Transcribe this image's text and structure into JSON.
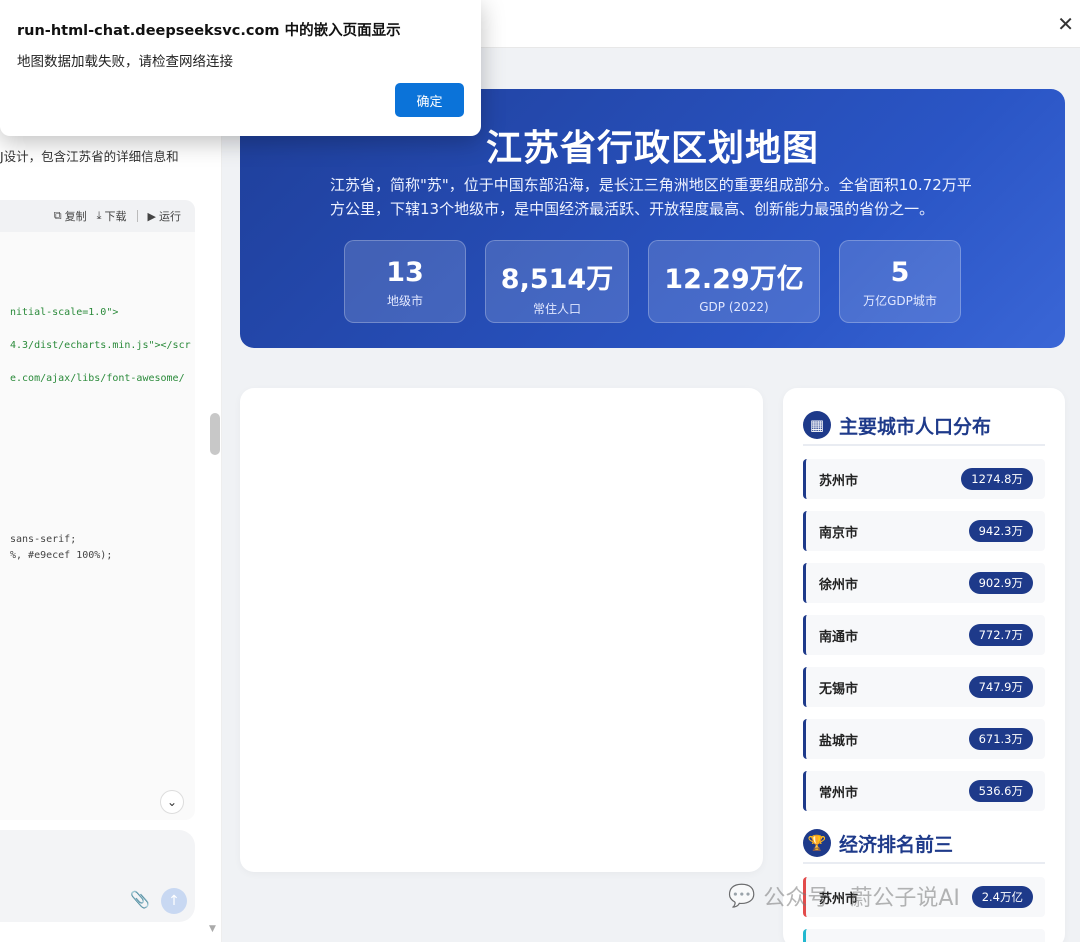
{
  "dialog": {
    "title": "run-html-chat.deepseeksvc.com 中的嵌入页面显示",
    "message": "地图数据加载失败，请检查网络连接",
    "ok_label": "确定"
  },
  "chat": {
    "description_tail": "J设计，包含江苏省的详细信息和",
    "toolbar": {
      "copy": "复制",
      "download": "下载",
      "run": "运行"
    },
    "code_lines": [
      "nitial-scale=1.0\">",
      "4.3/dist/echarts.min.js\"></scr",
      "e.com/ajax/libs/font-awesome/",
      "sans-serif;",
      "%, #e9ecef 100%);"
    ]
  },
  "hero": {
    "title": "江苏省行政区划地图",
    "description": "江苏省，简称\"苏\"，位于中国东部沿海，是长江三角洲地区的重要组成部分。全省面积10.72万平方公里，下辖13个地级市，是中国经济最活跃、开放程度最高、创新能力最强的省份之一。",
    "stats": [
      {
        "value": "13",
        "label": "地级市"
      },
      {
        "value": "8,514万",
        "label": "常住人口"
      },
      {
        "value": "12.29万亿",
        "label": "GDP (2022)"
      },
      {
        "value": "5",
        "label": "万亿GDP城市"
      }
    ]
  },
  "population": {
    "title": "主要城市人口分布",
    "icon": "city-icon",
    "cities": [
      {
        "name": "苏州市",
        "value": "1274.8万"
      },
      {
        "name": "南京市",
        "value": "942.3万"
      },
      {
        "name": "徐州市",
        "value": "902.9万"
      },
      {
        "name": "南通市",
        "value": "772.7万"
      },
      {
        "name": "无锡市",
        "value": "747.9万"
      },
      {
        "name": "盐城市",
        "value": "671.3万"
      },
      {
        "name": "常州市",
        "value": "536.6万"
      }
    ]
  },
  "economy": {
    "title": "经济排名前三",
    "icon": "trophy-icon",
    "cities": [
      {
        "name": "苏州市",
        "value": "2.4万亿"
      }
    ]
  },
  "watermark": "公众号 · 蔚公子说AI",
  "colors": {
    "accent": "#1e3a8a",
    "dialog_button": "#0b73d9",
    "hero_start": "#1f3f9a",
    "hero_end": "#3a66d6"
  }
}
